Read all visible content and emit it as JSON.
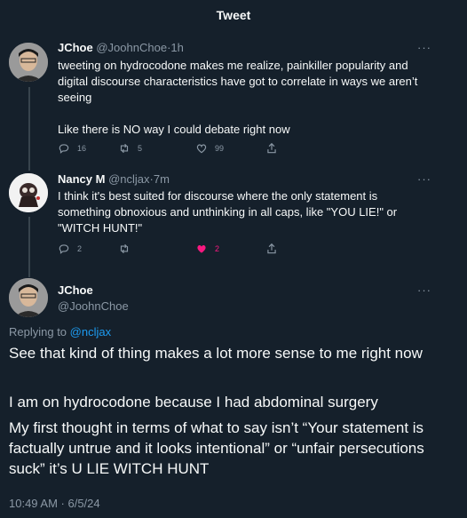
{
  "header": {
    "title": "Tweet"
  },
  "tweets": [
    {
      "name": "JChoe",
      "handle": "@JoohnChoe",
      "time": "1h",
      "lines": [
        "tweeting on hydrocodone makes me realize, painkiller popularity and",
        "digital discourse characteristics have got to correlate in ways we aren’t",
        "seeing",
        "",
        "Like there is NO way I could debate right now"
      ],
      "replies": "16",
      "retweets": "5",
      "likes": "99"
    },
    {
      "name": "Nancy M",
      "handle": "@ncljax",
      "time": "7m",
      "lines": [
        "I think it's best suited for discourse where the only statement is",
        "something obnoxious and unthinking in all caps, like  \"YOU LIE!\" or",
        "\"WITCH HUNT!\""
      ],
      "replies": "2",
      "retweets": "",
      "likes": "2",
      "like_color": "#f91880"
    }
  ],
  "main": {
    "name": "JChoe",
    "handle": "@JoohnChoe",
    "replying_prefix": "Replying to",
    "replying_to": "@ncljax",
    "paragraphs": [
      "See that kind of thing makes a lot more sense to me right now",
      "I am on hydrocodone because I had abdominal surgery",
      "My first thought in terms of what to say isn’t “Your statement is factually untrue and it looks intentional” or “unfair persecutions suck” it’s U LIE WITCH HUNT"
    ],
    "timestamp": "10:49 AM · 6/5/24"
  },
  "more_label": "···",
  "dot": "·",
  "icons": [
    "reply-icon",
    "retweet-icon",
    "like-icon",
    "share-icon",
    "more-icon"
  ]
}
